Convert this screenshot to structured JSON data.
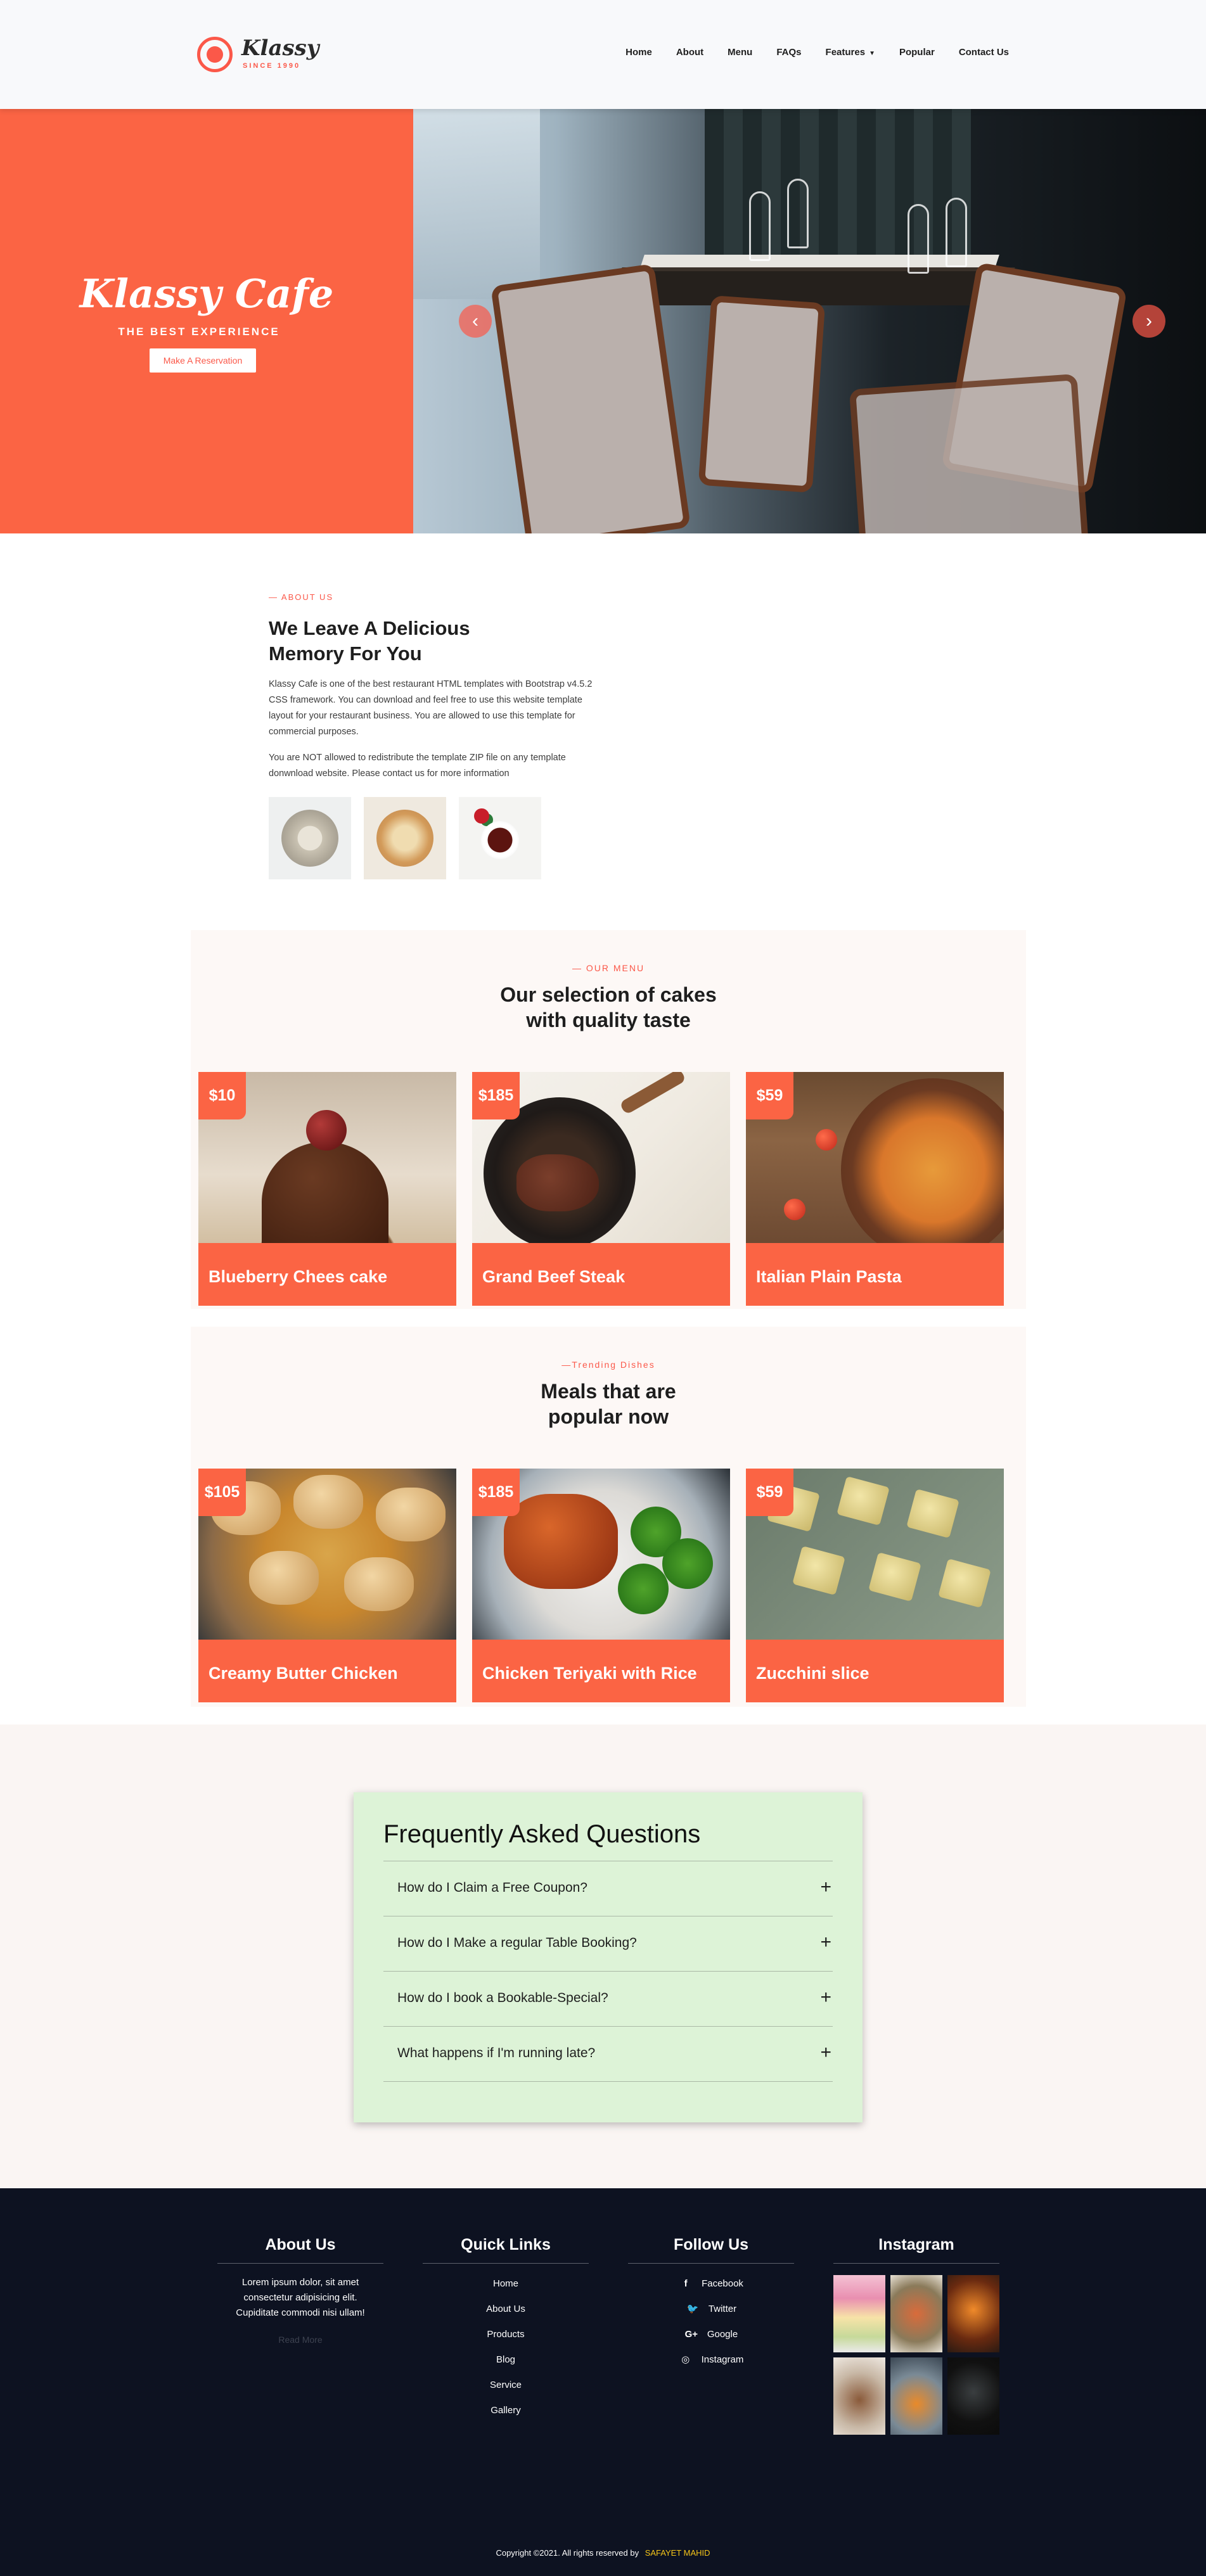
{
  "brand": {
    "name": "Klassy",
    "since": "SINCE 1990"
  },
  "nav": [
    "Home",
    "About",
    "Menu",
    "FAQs",
    "Features",
    "Popular",
    "Contact Us"
  ],
  "hero": {
    "title": "Klassy Cafe",
    "subtitle": "THE BEST EXPERIENCE",
    "button": "Make A Reservation",
    "prev_icon": "chevron-left-icon",
    "next_icon": "chevron-right-icon"
  },
  "about": {
    "eyebrow": "— ABOUT US",
    "title_line1": "We Leave A Delicious",
    "title_line2": "Memory For You",
    "para1": "Klassy Cafe is one of the best restaurant HTML templates with Bootstrap v4.5.2 CSS framework. You can download and feel free to use this website template layout for your restaurant business. You are allowed to use this template for commercial purposes.",
    "para2": "You are NOT allowed to redistribute the template ZIP file on any template donwnload website. Please contact us for more information"
  },
  "menu": {
    "eyebrow": "— OUR MENU",
    "title_line1": "Our selection of cakes",
    "title_line2": "with quality taste",
    "items": [
      {
        "price": "$10",
        "name": "Blueberry Chees cake"
      },
      {
        "price": "$185",
        "name": "Grand Beef Steak"
      },
      {
        "price": "$59",
        "name": "Italian Plain Pasta"
      }
    ]
  },
  "trending": {
    "eyebrow": "—Trending Dishes",
    "title_line1": "Meals that are",
    "title_line2": "popular now",
    "items": [
      {
        "price": "$105",
        "name": "Creamy Butter Chicken"
      },
      {
        "price": "$185",
        "name": "Chicken Teriyaki with Rice"
      },
      {
        "price": "$59",
        "name": "Zucchini slice"
      }
    ]
  },
  "faq": {
    "title": "Frequently Asked Questions",
    "items": [
      "How do I Claim a Free Coupon?",
      "How do I Make a regular Table Booking?",
      "How do I book a Bookable-Special?",
      "What happens if I'm running late?"
    ],
    "toggle_symbol": "+"
  },
  "footer": {
    "about": {
      "title": "About Us",
      "text": "Lorem ipsum dolor, sit amet consectetur adipisicing elit. Cupiditate commodi nisi ullam!",
      "readmore": "Read More"
    },
    "quick_links": {
      "title": "Quick Links",
      "items": [
        "Home",
        "About Us",
        "Products",
        "Blog",
        "Service",
        "Gallery"
      ]
    },
    "follow": {
      "title": "Follow Us",
      "items": [
        {
          "icon": "f",
          "label": "Facebook"
        },
        {
          "icon": "🐦",
          "label": "Twitter"
        },
        {
          "icon": "G+",
          "label": "Google"
        },
        {
          "icon": "◎",
          "label": "Instagram"
        }
      ]
    },
    "instagram": {
      "title": "Instagram"
    },
    "copyright": "Copyright ©2021. All rights reserved by",
    "author": "SAFAYET MAHID"
  },
  "colors": {
    "accent": "#fb5849",
    "hero_orange": "#fb6444",
    "faq_bg": "#ddf3d7",
    "footer_bg": "#0d1221",
    "author_yellow": "#f5c518"
  }
}
